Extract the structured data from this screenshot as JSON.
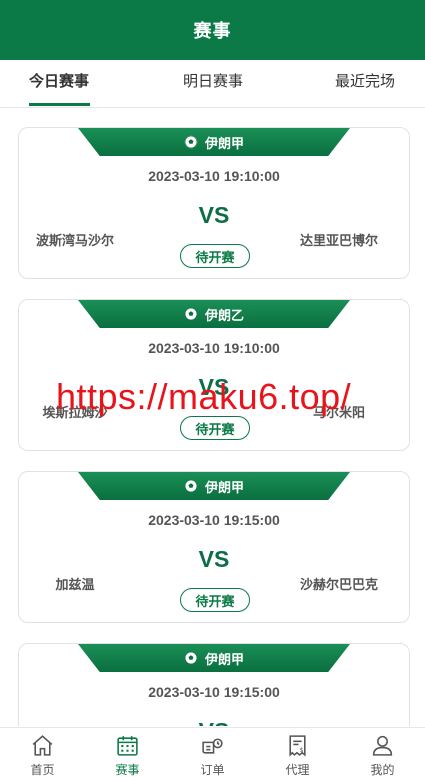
{
  "header": {
    "title": "赛事"
  },
  "tabs": [
    {
      "label": "今日赛事",
      "active": true
    },
    {
      "label": "明日赛事",
      "active": false
    },
    {
      "label": "最近完场",
      "active": false
    }
  ],
  "matches": [
    {
      "league": "伊朗甲",
      "time": "2023-03-10 19:10:00",
      "vs": "VS",
      "home": "波斯湾马沙尔",
      "away": "达里亚巴博尔",
      "status": "待开赛"
    },
    {
      "league": "伊朗乙",
      "time": "2023-03-10 19:10:00",
      "vs": "VS",
      "home": "埃斯拉姆沙",
      "away": "马尔米阳",
      "status": "待开赛"
    },
    {
      "league": "伊朗甲",
      "time": "2023-03-10 19:15:00",
      "vs": "VS",
      "home": "加兹温",
      "away": "沙赫尔巴巴克",
      "status": "待开赛"
    },
    {
      "league": "伊朗甲",
      "time": "2023-03-10 19:15:00",
      "vs": "VS",
      "home": "",
      "away": "",
      "status": ""
    }
  ],
  "watermark": "https://maku6.top/",
  "nav": [
    {
      "label": "首页",
      "icon": "home-icon",
      "active": false
    },
    {
      "label": "赛事",
      "icon": "calendar-icon",
      "active": true
    },
    {
      "label": "订单",
      "icon": "order-icon",
      "active": false
    },
    {
      "label": "代理",
      "icon": "agent-icon",
      "active": false
    },
    {
      "label": "我的",
      "icon": "user-icon",
      "active": false
    }
  ],
  "colors": {
    "brand": "#0b7a46",
    "watermark": "#e8141b"
  }
}
